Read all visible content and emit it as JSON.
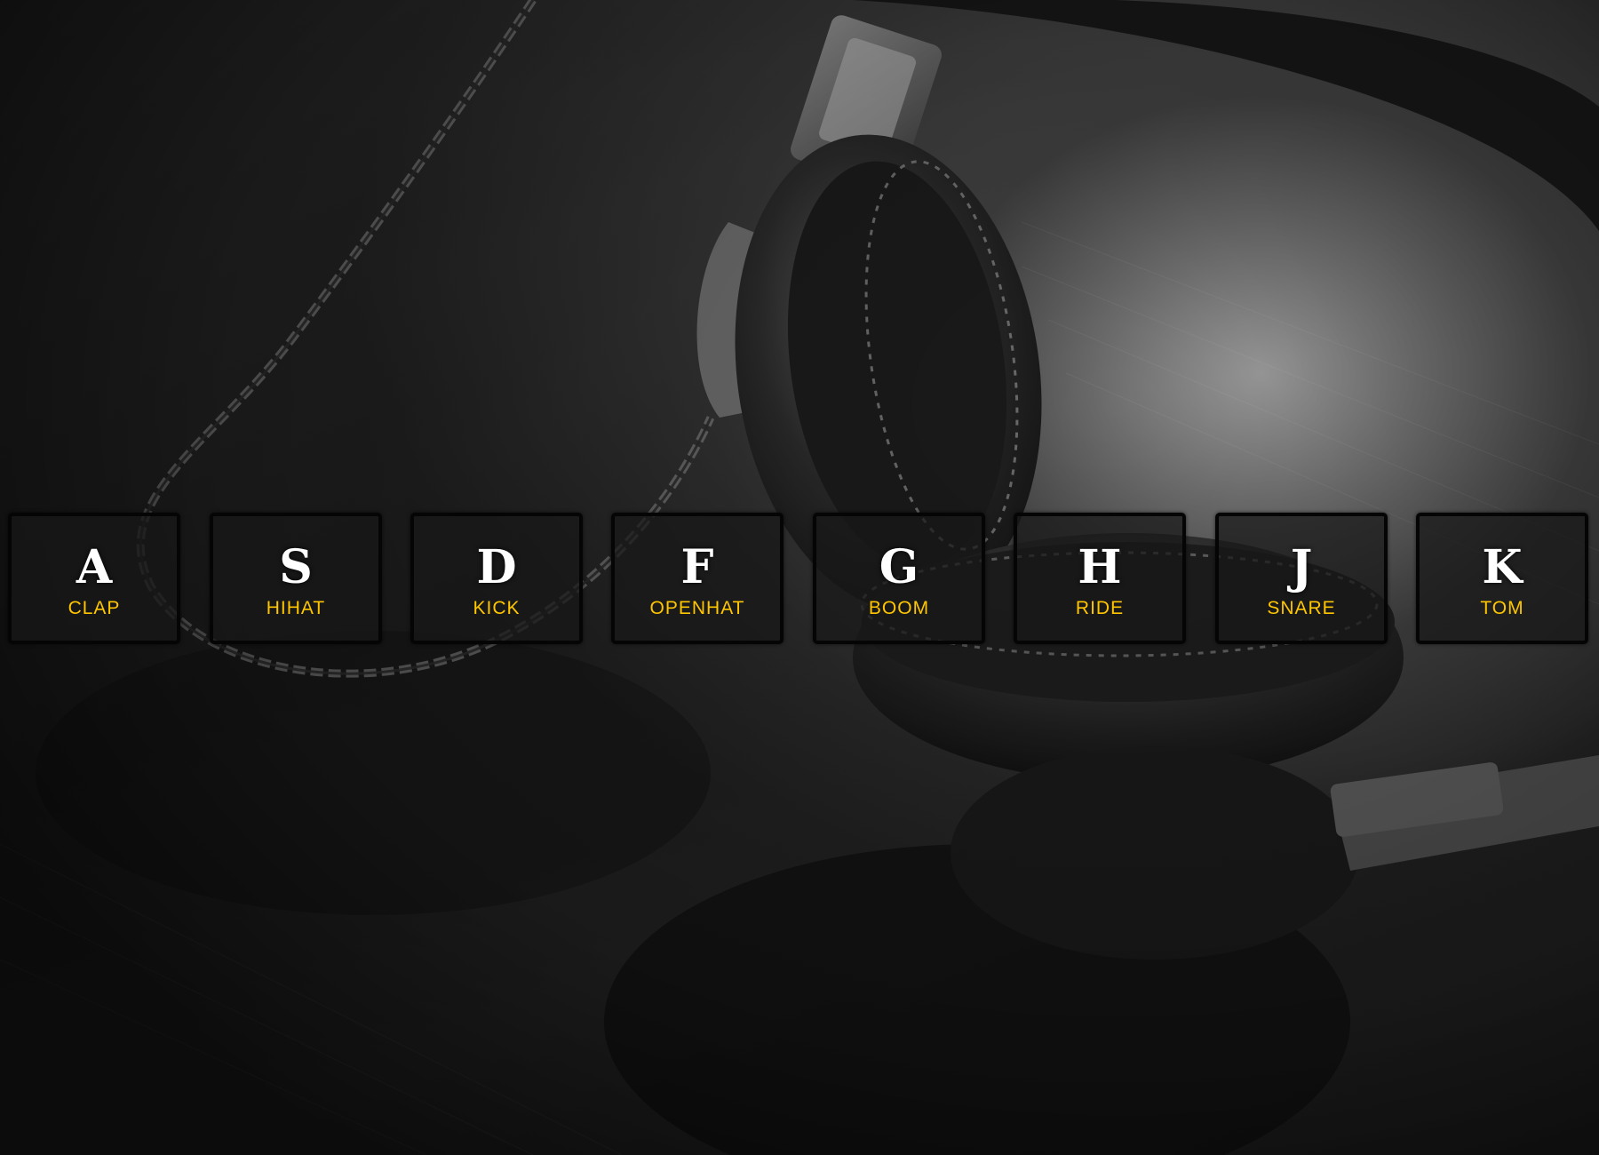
{
  "background": {
    "description_icon": "headphones-photo"
  },
  "colors": {
    "accent": "#ffc600",
    "key_text": "#ffffff",
    "key_border": "#050505"
  },
  "keys": [
    {
      "letter": "A",
      "sound": "CLAP"
    },
    {
      "letter": "S",
      "sound": "HIHAT"
    },
    {
      "letter": "D",
      "sound": "KICK"
    },
    {
      "letter": "F",
      "sound": "OPENHAT"
    },
    {
      "letter": "G",
      "sound": "BOOM"
    },
    {
      "letter": "H",
      "sound": "RIDE"
    },
    {
      "letter": "J",
      "sound": "SNARE"
    },
    {
      "letter": "K",
      "sound": "TOM"
    }
  ]
}
